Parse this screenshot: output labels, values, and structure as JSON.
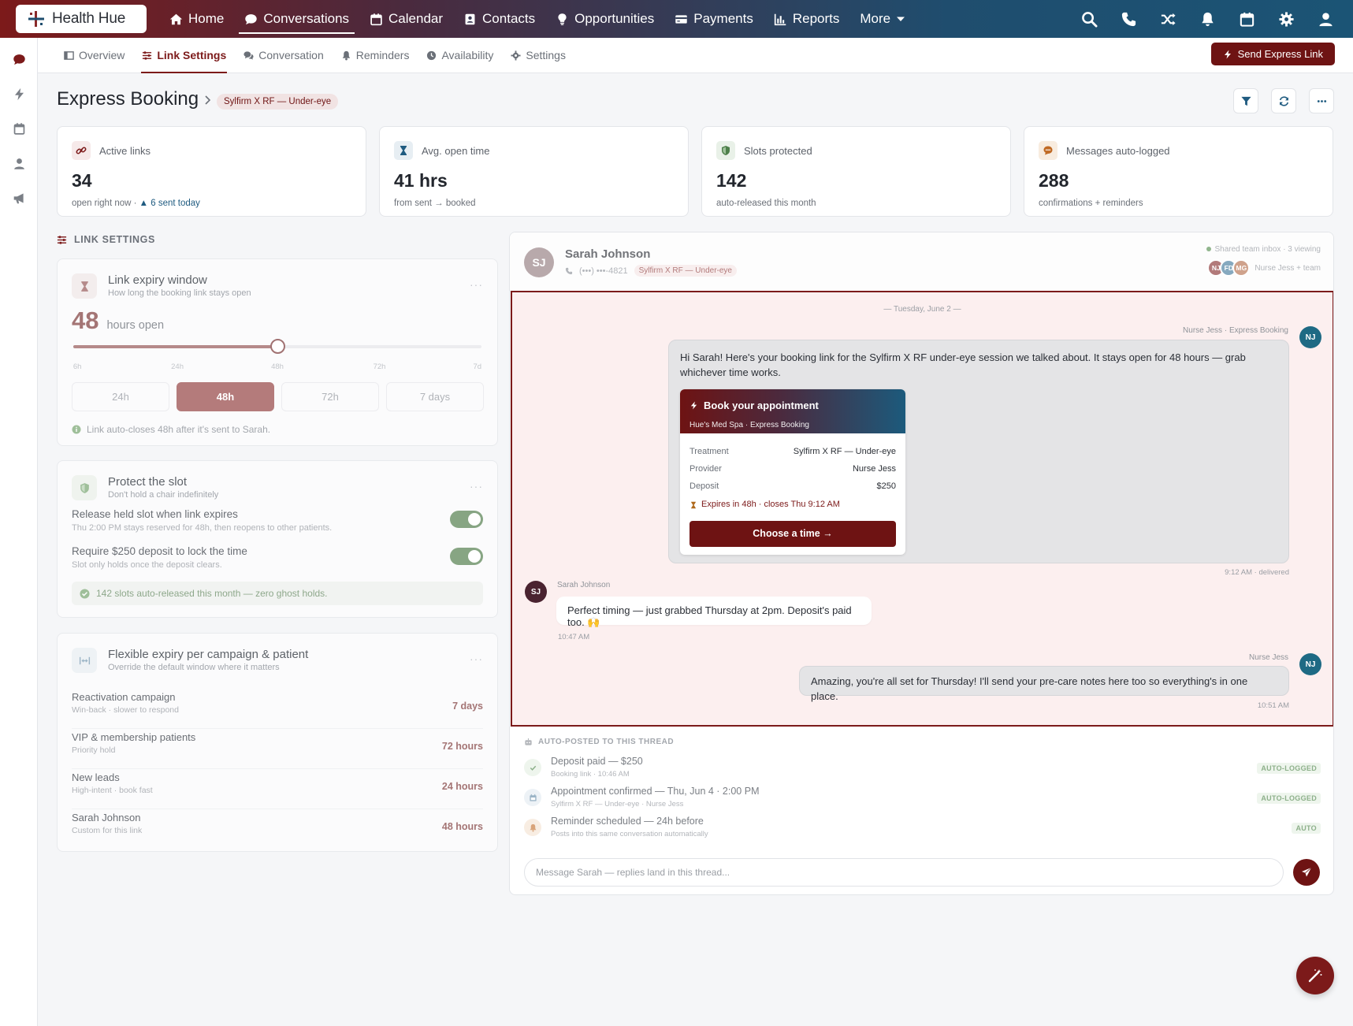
{
  "brand": {
    "name": "Health Hue",
    "accent": "#7c1a1a",
    "secondary": "#1b5475"
  },
  "topnav": {
    "items": [
      {
        "label": "Home",
        "icon": "home-icon"
      },
      {
        "label": "Conversations",
        "icon": "chat-icon",
        "active": true
      },
      {
        "label": "Calendar",
        "icon": "calendar-icon"
      },
      {
        "label": "Contacts",
        "icon": "contacts-icon"
      },
      {
        "label": "Opportunities",
        "icon": "lightbulb-icon"
      },
      {
        "label": "Payments",
        "icon": "credit-card-icon"
      },
      {
        "label": "Reports",
        "icon": "bar-chart-icon"
      },
      {
        "label": "More",
        "icon": "caret-down-icon"
      }
    ],
    "right_icons": [
      "search-icon",
      "phone-icon",
      "shuffle-icon",
      "bell-icon",
      "calendar-icon",
      "gear-icon",
      "user-icon"
    ]
  },
  "rail": {
    "icons": [
      "chat-icon",
      "bolt-icon",
      "calendar-icon",
      "user-icon",
      "megaphone-icon"
    ]
  },
  "subnav": {
    "tabs": [
      {
        "label": "Overview",
        "icon": "window-icon"
      },
      {
        "label": "Link Settings",
        "icon": "sliders-icon",
        "active": true
      },
      {
        "label": "Conversation",
        "icon": "chat-icon"
      },
      {
        "label": "Reminders",
        "icon": "bell-icon"
      },
      {
        "label": "Availability",
        "icon": "clock-icon"
      },
      {
        "label": "Settings",
        "icon": "gear-icon"
      }
    ],
    "send_button": "Send Express Link"
  },
  "header": {
    "title": "Express Booking",
    "chip": "Sylfirm X RF — Under-eye"
  },
  "stats": [
    {
      "label": "Active links",
      "value": "34",
      "sub": "open right now ·",
      "sub_extra": "▲ 6 sent today",
      "icon": "link-icon"
    },
    {
      "label": "Avg. open time",
      "value": "41 hrs",
      "sub": "from sent → booked",
      "icon": "hourglass-icon"
    },
    {
      "label": "Slots protected",
      "value": "142",
      "sub": "auto-released this month",
      "icon": "shield-icon"
    },
    {
      "label": "Messages auto-logged",
      "value": "288",
      "sub": "confirmations + reminders",
      "icon": "comment-icon"
    }
  ],
  "link_settings": {
    "label": "LINK SETTINGS",
    "expiry": {
      "title": "Link expiry window",
      "subtitle": "How long the booking link stays open",
      "value": "48",
      "unit": "hours open",
      "slider_fraction": 0.5,
      "ticks": [
        "6h",
        "24h",
        "48h",
        "72h",
        "7d"
      ],
      "options": [
        "24h",
        "48h",
        "72h",
        "7 days"
      ],
      "selected": "48h",
      "note": "Link auto-closes 48h after it's sent to Sarah."
    },
    "protect": {
      "title": "Protect the slot",
      "subtitle": "Don't hold a chair indefinitely",
      "toggles": [
        {
          "title": "Release held slot when link expires",
          "sub": "Thu 2:00 PM stays reserved for 48h, then reopens to other patients.",
          "on": true
        },
        {
          "title": "Require $250 deposit to lock the time",
          "sub": "Slot only holds once the deposit clears.",
          "on": true
        }
      ],
      "banner": "142 slots auto-released this month — zero ghost holds."
    },
    "flex": {
      "title": "Flexible expiry per campaign & patient",
      "subtitle": "Override the default window where it matters",
      "rows": [
        {
          "title": "Reactivation campaign",
          "sub": "Win-back · slower to respond",
          "value": "7 days"
        },
        {
          "title": "VIP & membership patients",
          "sub": "Priority hold",
          "value": "72 hours"
        },
        {
          "title": "New leads",
          "sub": "High-intent · book fast",
          "value": "24 hours"
        },
        {
          "title": "Sarah Johnson",
          "sub": "Custom for this link",
          "value": "48 hours"
        }
      ]
    }
  },
  "conversation": {
    "contact": {
      "initials": "SJ",
      "name": "Sarah Johnson",
      "phone": "(•••) •••-4821",
      "chip": "Sylfirm X RF — Under-eye"
    },
    "presence": "Shared team inbox · 3 viewing",
    "team_avatars": [
      "NJ",
      "FD",
      "MG"
    ],
    "team_label": "Nurse Jess + team",
    "date_sep": "— Tuesday, June 2 —",
    "msg1": {
      "sender": "Nurse Jess · Express Booking",
      "avatar": "NJ",
      "text": "Hi Sarah! Here's your booking link for the Sylfirm X RF under-eye session we talked about. It stays open for 48 hours — grab whichever time works.",
      "time": "9:12 AM · delivered"
    },
    "booking_card": {
      "title": "Book your appointment",
      "subtitle": "Hue's Med Spa · Express Booking",
      "rows": [
        {
          "k": "Treatment",
          "v": "Sylfirm X RF — Under-eye"
        },
        {
          "k": "Provider",
          "v": "Nurse Jess"
        },
        {
          "k": "Deposit",
          "v": "$250"
        }
      ],
      "expires": "Expires in 48h · closes Thu 9:12 AM",
      "button": "Choose a time →"
    },
    "msg2": {
      "sender": "Sarah Johnson",
      "avatar": "SJ",
      "text": "Perfect timing — just grabbed Thursday at 2pm. Deposit's paid too. 🙌",
      "time": "10:47 AM"
    },
    "msg3": {
      "sender": "Nurse Jess",
      "avatar": "NJ",
      "text": "Amazing, you're all set for Thursday! I'll send your pre-care notes here too so everything's in one place.",
      "time": "10:51 AM"
    },
    "auto_label": "AUTO-POSTED TO THIS THREAD",
    "auto": [
      {
        "title": "Deposit paid — $250",
        "sub": "Booking link · 10:46 AM",
        "badge": "AUTO-LOGGED",
        "icon": "check-icon"
      },
      {
        "title": "Appointment confirmed — Thu, Jun 4 · 2:00 PM",
        "sub": "Sylfirm X RF — Under-eye · Nurse Jess",
        "badge": "AUTO-LOGGED",
        "icon": "calendar-icon"
      },
      {
        "title": "Reminder scheduled — 24h before",
        "sub": "Posts into this same conversation automatically",
        "badge": "AUTO",
        "icon": "bell-icon"
      }
    ],
    "composer_placeholder": "Message Sarah — replies land in this thread..."
  }
}
